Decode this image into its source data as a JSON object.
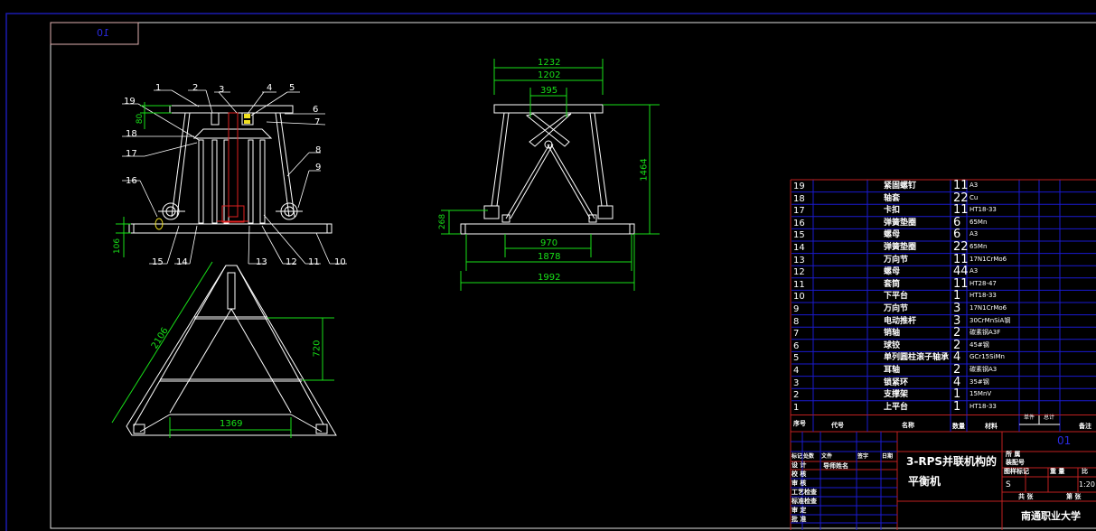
{
  "frame": {
    "sheet_label": "10"
  },
  "front_view": {
    "callouts": [
      "1",
      "2",
      "3",
      "4",
      "5",
      "6",
      "7",
      "8",
      "9",
      "10",
      "11",
      "12",
      "13",
      "14",
      "15",
      "16",
      "17",
      "18",
      "19"
    ],
    "dims": {
      "top_thickness": "80",
      "base_thickness": "106"
    }
  },
  "side_view": {
    "dims": {
      "top_outer": "1232",
      "top_inner": "1202",
      "top_joint": "395",
      "height": "1464",
      "base_height": "268",
      "base_joint": "970",
      "base_inner": "1878",
      "base_outer": "1992"
    }
  },
  "plan_view": {
    "dims": {
      "leg_length": "2106",
      "spacing": "720",
      "base_span": "1369"
    }
  },
  "parts_list": {
    "rows": [
      {
        "no": "19",
        "name": "紧固螺钉",
        "qty": "11",
        "material": "A3"
      },
      {
        "no": "18",
        "name": "轴套",
        "qty": "22",
        "material": "Cu"
      },
      {
        "no": "17",
        "name": "卡扣",
        "qty": "11",
        "material": "HT18-33"
      },
      {
        "no": "16",
        "name": "弹簧垫圈",
        "qty": "6",
        "material": "65Mn"
      },
      {
        "no": "15",
        "name": "螺母",
        "qty": "6",
        "material": "A3"
      },
      {
        "no": "14",
        "name": "弹簧垫圈",
        "qty": "22",
        "material": "65Mn"
      },
      {
        "no": "13",
        "name": "万向节",
        "qty": "11",
        "material": "17N1CrMo6"
      },
      {
        "no": "12",
        "name": "螺母",
        "qty": "44",
        "material": "A3"
      },
      {
        "no": "11",
        "name": "套筒",
        "qty": "11",
        "material": "HT28-47"
      },
      {
        "no": "10",
        "name": "下平台",
        "qty": "1",
        "material": "HT18-33"
      },
      {
        "no": "9",
        "name": "万向节",
        "qty": "3",
        "material": "17N1CrMo6"
      },
      {
        "no": "8",
        "name": "电动推杆",
        "qty": "3",
        "material": "30CrMnSiA钢"
      },
      {
        "no": "7",
        "name": "销轴",
        "qty": "2",
        "material": "碳素钢A3F"
      },
      {
        "no": "6",
        "name": "球铰",
        "qty": "2",
        "material": "45#钢"
      },
      {
        "no": "5",
        "name": "单列圆柱滚子轴承",
        "qty": "4",
        "material": "GCr15SiMn"
      },
      {
        "no": "4",
        "name": "耳轴",
        "qty": "2",
        "material": "碳素钢A3"
      },
      {
        "no": "3",
        "name": "锁紧环",
        "qty": "4",
        "material": "35#钢"
      },
      {
        "no": "2",
        "name": "支撑架",
        "qty": "1",
        "material": "15MnV"
      },
      {
        "no": "1",
        "name": "上平台",
        "qty": "1",
        "material": "HT18-33"
      }
    ],
    "header": {
      "no": "序号",
      "code": "代号",
      "name": "名称",
      "qty": "数量",
      "material": "材料",
      "unit_weight": "单件",
      "total_weight": "总计",
      "remark": "备注"
    }
  },
  "title_block": {
    "title_line1": "3-RPS并联机构的",
    "title_line2": "平衡机",
    "drawing_no": "01",
    "revision_header": [
      "标记",
      "处数",
      "文件",
      "签字",
      "日期"
    ],
    "roles": [
      "设 计",
      "校 核",
      "审 核",
      "工艺检查",
      "标准检查",
      "审 定",
      "批 准"
    ],
    "designer": "导师姓名",
    "belongs": "所 属",
    "assembly_no": "装配号",
    "sample_mark": "图样标记",
    "weight": "重 量",
    "scale_label": "比",
    "mark_value": "S",
    "scale": "1:20",
    "total_sheets": "共 张",
    "sheet": "第 张",
    "institution": "南通职业大学"
  },
  "colors": {
    "background": "#000000",
    "lines": "#ffffff",
    "dimensions": "#18e018",
    "table_grid": "#1a1ad0",
    "table_border": "#c02020",
    "frame": "#1a1ab0"
  }
}
